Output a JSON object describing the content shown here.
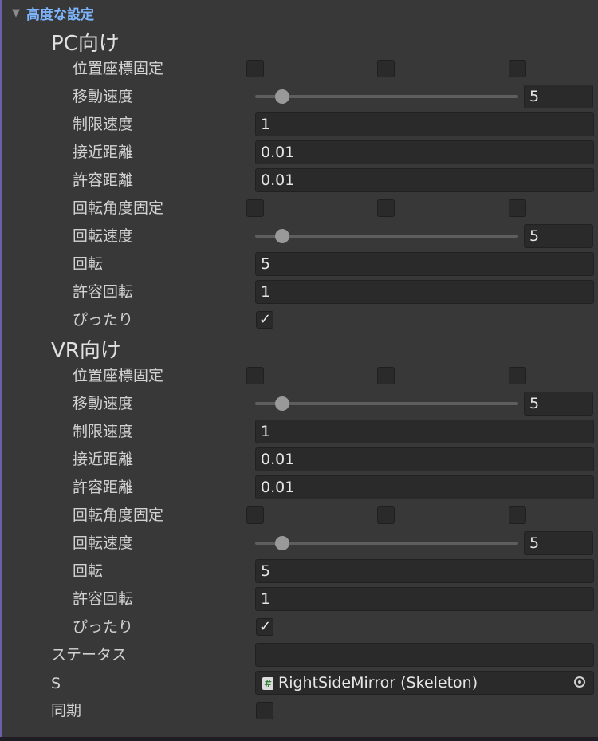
{
  "header": {
    "foldout_label": "高度な設定"
  },
  "pc": {
    "title": "PC向け",
    "position_lock": {
      "label": "位置座標固定",
      "x": false,
      "y": false,
      "z": false
    },
    "move_speed": {
      "label": "移動速度",
      "value": "5"
    },
    "speed_limit": {
      "label": "制限速度",
      "value": "1"
    },
    "approach_distance": {
      "label": "接近距離",
      "value": "0.01"
    },
    "tolerance_distance": {
      "label": "許容距離",
      "value": "0.01"
    },
    "rotation_lock": {
      "label": "回転角度固定",
      "x": false,
      "y": false,
      "z": false
    },
    "rotation_speed": {
      "label": "回転速度",
      "value": "5"
    },
    "rotation": {
      "label": "回転",
      "value": "5"
    },
    "tolerance_rotation": {
      "label": "許容回転",
      "value": "1"
    },
    "snug": {
      "label": "ぴったり",
      "checked": true
    }
  },
  "vr": {
    "title": "VR向け",
    "position_lock": {
      "label": "位置座標固定",
      "x": false,
      "y": false,
      "z": false
    },
    "move_speed": {
      "label": "移動速度",
      "value": "5"
    },
    "speed_limit": {
      "label": "制限速度",
      "value": "1"
    },
    "approach_distance": {
      "label": "接近距離",
      "value": "0.01"
    },
    "tolerance_distance": {
      "label": "許容距離",
      "value": "0.01"
    },
    "rotation_lock": {
      "label": "回転角度固定",
      "x": false,
      "y": false,
      "z": false
    },
    "rotation_speed": {
      "label": "回転速度",
      "value": "5"
    },
    "rotation": {
      "label": "回転",
      "value": "5"
    },
    "tolerance_rotation": {
      "label": "許容回転",
      "value": "1"
    },
    "snug": {
      "label": "ぴったり",
      "checked": true
    }
  },
  "status": {
    "label": "ステータス",
    "value": ""
  },
  "s_field": {
    "label": "S",
    "value": "RightSideMirror (Skeleton)",
    "icon": "script-icon",
    "picker_icon": "object-picker-icon"
  },
  "sync": {
    "label": "同期",
    "checked": false
  },
  "colors": {
    "background": "#383838",
    "field": "#2a2a2a",
    "foldout": "#7eb6ff",
    "accent_border": "#6a5fa8"
  }
}
